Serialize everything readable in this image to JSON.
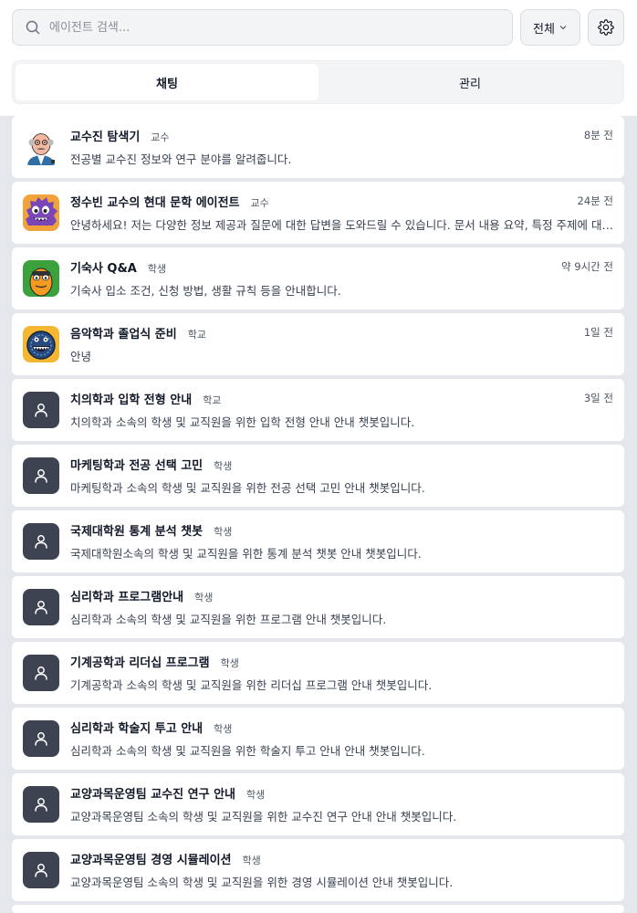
{
  "search": {
    "placeholder": "에이전트 검색..."
  },
  "filter": {
    "label": "전체"
  },
  "tabs": [
    {
      "label": "채팅",
      "active": true
    },
    {
      "label": "관리",
      "active": false
    }
  ],
  "agents": [
    {
      "name": "교수진 탐색기",
      "role": "교수",
      "time": "8분 전",
      "desc": "전공별 교수진 정보와 연구 분야를 알려줍니다.",
      "icon": "professor-avatar-icon"
    },
    {
      "name": "정수빈 교수의 현대 문학 에이전트",
      "role": "교수",
      "time": "24분 전",
      "desc": "안녕하세요! 저는 다양한 정보 제공과 질문에 대한 답변을 도와드릴 수 있습니다. 문서 내용 요약, 특정 주제에 대한 설명 등을 도와드립니다.",
      "icon": "purple-monster-avatar-icon"
    },
    {
      "name": "기숙사 Q&A",
      "role": "학생",
      "time": "약 9시간 전",
      "desc": "기숙사 입소 조건, 신청 방법, 생활 규칙 등을 안내합니다.",
      "icon": "orange-character-avatar-icon"
    },
    {
      "name": "음악학과 졸업식 준비",
      "role": "학교",
      "time": "1일 전",
      "desc": "안녕",
      "icon": "blue-monster-avatar-icon"
    },
    {
      "name": "치의학과 입학 전형 안내",
      "role": "학교",
      "time": "3일 전",
      "desc": "치의학과 소속의 학생 및 교직원을 위한 입학 전형 안내 안내 챗봇입니다.",
      "icon": "user-icon"
    },
    {
      "name": "마케팅학과 전공 선택 고민",
      "role": "학생",
      "time": "",
      "desc": "마케팅학과 소속의 학생 및 교직원을 위한 전공 선택 고민 안내 챗봇입니다.",
      "icon": "user-icon"
    },
    {
      "name": "국제대학원 통계 분석 챗봇",
      "role": "학생",
      "time": "",
      "desc": "국제대학원소속의 학생 및 교직원을 위한 통계 분석 챗봇 안내 챗봇입니다.",
      "icon": "user-icon"
    },
    {
      "name": "심리학과 프로그램안내",
      "role": "학생",
      "time": "",
      "desc": "심리학과 소속의 학생 및 교직원을 위한 프로그램 안내 챗봇입니다.",
      "icon": "user-icon"
    },
    {
      "name": "기계공학과 리더십 프로그램",
      "role": "학생",
      "time": "",
      "desc": "기계공학과 소속의 학생 및 교직원을 위한 리더십 프로그램 안내 챗봇입니다.",
      "icon": "user-icon"
    },
    {
      "name": "심리학과 학술지 투고 안내",
      "role": "학생",
      "time": "",
      "desc": "심리학과 소속의 학생 및 교직원을 위한 학술지 투고 안내 안내 챗봇입니다.",
      "icon": "user-icon"
    },
    {
      "name": "교양과목운영팀 교수진 연구 안내",
      "role": "학생",
      "time": "",
      "desc": "교양과목운영팀 소속의 학생 및 교직원을 위한 교수진 연구 안내 안내 챗봇입니다.",
      "icon": "user-icon"
    },
    {
      "name": "교양과목운영팀 경영 시뮬레이션",
      "role": "학생",
      "time": "",
      "desc": "교양과목운영팀 소속의 학생 및 교직원을 위한 경영 시뮬레이션 안내 챗봇입니다.",
      "icon": "user-icon"
    }
  ]
}
